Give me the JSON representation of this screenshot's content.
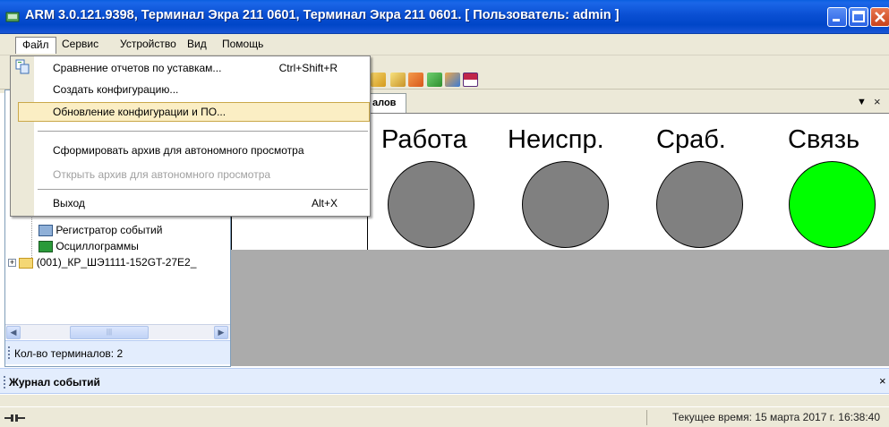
{
  "window": {
    "title": "ARM 3.0.121.9398, Терминал Экра 211 0601, Терминал Экра 211 0601. [ Пользователь: admin ]"
  },
  "menubar": {
    "items": [
      "Файл",
      "Сервис",
      "Устройство",
      "Вид",
      "Помощь"
    ]
  },
  "file_menu": {
    "items": [
      {
        "label": "Сравнение отчетов по уставкам...",
        "shortcut": "Ctrl+Shift+R",
        "enabled": true,
        "icon": "compare-reports-icon"
      },
      {
        "label": "Создать конфигурацию...",
        "shortcut": "",
        "enabled": true
      },
      {
        "label": "Обновление конфигурации и ПО...",
        "shortcut": "",
        "enabled": true,
        "highlighted": true
      },
      {
        "label": "Сформировать архив для автономного просмотра",
        "shortcut": "",
        "enabled": true
      },
      {
        "label": "Открыть архив для автономного просмотра",
        "shortcut": "",
        "enabled": false
      },
      {
        "label": "Выход",
        "shortcut": "Alt+X",
        "enabled": true
      }
    ]
  },
  "tree": {
    "items": [
      {
        "label": "Регистратор событий",
        "icon": "event-recorder-icon"
      },
      {
        "label": "Осциллограммы",
        "icon": "oscillogram-icon"
      },
      {
        "label": "(001)_КР_ШЭ1111-152GT-27E2_",
        "icon": "folder-icon"
      }
    ]
  },
  "left_status": {
    "terminal_count": "Кол-во терминалов: 2"
  },
  "tab": {
    "label": "алов"
  },
  "indicators": [
    {
      "label": "Работа",
      "color": "#808080"
    },
    {
      "label": "Неиспр.",
      "color": "#808080"
    },
    {
      "label": "Сраб.",
      "color": "#808080"
    },
    {
      "label": "Связь",
      "color": "#00ff00"
    }
  ],
  "journal": {
    "title": "Журнал событий"
  },
  "statusbar": {
    "current_time": "Текущее время: 15 марта 2017 г. 16:38:40"
  },
  "colors": {
    "title_blue": "#0a4fd3",
    "menu_highlight": "#fbeec4",
    "indicator_off": "#808080",
    "indicator_on": "#00ff00"
  }
}
